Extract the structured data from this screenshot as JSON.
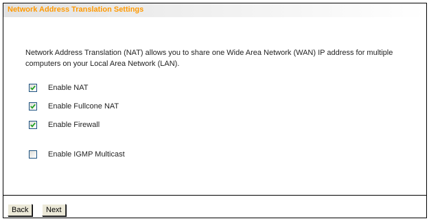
{
  "header": {
    "title": "Network Address Translation Settings",
    "title_color": "#ff9900"
  },
  "description": "Network Address Translation (NAT) allows you to share one Wide Area Network (WAN) IP address for multiple computers on your Local Area Network (LAN).",
  "options": {
    "enable_nat": {
      "label": "Enable NAT",
      "checked": true
    },
    "enable_fullcone_nat": {
      "label": "Enable Fullcone NAT",
      "checked": true
    },
    "enable_firewall": {
      "label": "Enable Firewall",
      "checked": true
    },
    "enable_igmp_multicast": {
      "label": "Enable IGMP Multicast",
      "checked": false
    }
  },
  "buttons": {
    "back_label": "Back",
    "next_label": "Next"
  },
  "icons": {
    "checkbox_checked": "checkmark-icon"
  },
  "colors": {
    "checkmark": "#21a121",
    "checkbox_border": "#1c5180"
  }
}
